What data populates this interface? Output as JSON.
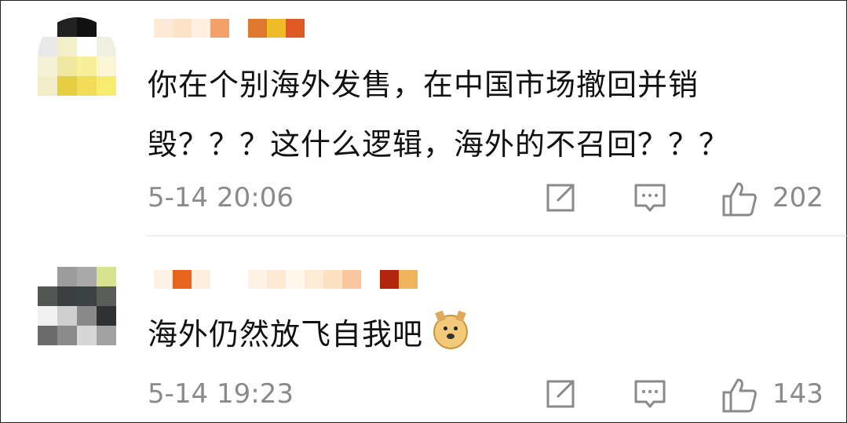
{
  "comments": [
    {
      "text_line1": "你在个别海外发售，在中国市场撤回并销",
      "text_line2": "毁？？？这什么逻辑，海外的不召回？？？",
      "timestamp": "5-14 20:06",
      "like_count": "202",
      "avatar_icon": "pixelated-avatar",
      "username_colors": [
        "#fde9d6",
        "#fde3c8",
        "#f4a06a",
        "#f08f55",
        "#e8732a",
        "#eebc25",
        "#e05a26"
      ]
    },
    {
      "text": "海外仍然放飞自我吧",
      "emoji_icon": "doge-emoji-icon",
      "timestamp": "5-14 19:23",
      "like_count": "143",
      "avatar_icon": "pixelated-avatar",
      "username_colors": [
        "#fef1e6",
        "#e8641e",
        "#fdeedd",
        "#fff3e6",
        "#fde8d4",
        "#fdebd6",
        "#fce1c2",
        "#f9c6a0",
        "#b4250e",
        "#f0b45c"
      ]
    }
  ],
  "actions": {
    "share_icon": "share-edit-icon",
    "comment_icon": "comment-bubble-icon",
    "like_icon": "thumbs-up-icon"
  },
  "colors": {
    "text": "#111111",
    "meta": "#8a8a8a",
    "divider": "#e3e3e3"
  }
}
